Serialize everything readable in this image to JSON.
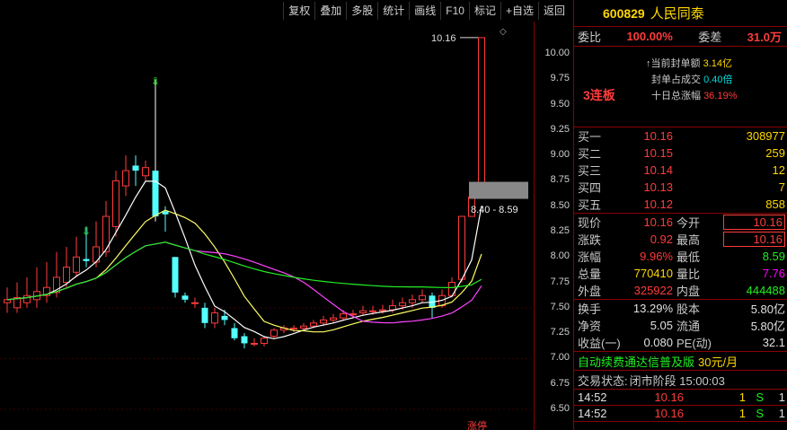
{
  "toolbar": [
    "复权",
    "叠加",
    "多股",
    "统计",
    "画线",
    "F10",
    "标记",
    "+自选",
    "返回"
  ],
  "chart_data": {
    "type": "candlestick",
    "price_ticks": [
      "10.00",
      "9.75",
      "9.50",
      "9.25",
      "9.00",
      "8.75",
      "8.50",
      "8.25",
      "8.00",
      "7.75",
      "7.50",
      "7.25",
      "7.00",
      "6.75",
      "6.50"
    ],
    "annotations": {
      "high_label": "10.16",
      "range_label": "8.40 - 8.59",
      "bottom_label": "涨停"
    },
    "candles": [
      {
        "o": 7.55,
        "c": 7.58,
        "h": 7.7,
        "l": 7.45
      },
      {
        "o": 7.5,
        "c": 7.6,
        "h": 7.75,
        "l": 7.45
      },
      {
        "o": 7.55,
        "c": 7.62,
        "h": 7.8,
        "l": 7.5
      },
      {
        "o": 7.58,
        "c": 7.66,
        "h": 7.9,
        "l": 7.5
      },
      {
        "o": 7.62,
        "c": 7.7,
        "h": 7.95,
        "l": 7.55
      },
      {
        "o": 7.65,
        "c": 7.8,
        "h": 8.05,
        "l": 7.6
      },
      {
        "o": 7.75,
        "c": 7.9,
        "h": 8.1,
        "l": 7.7
      },
      {
        "o": 7.85,
        "c": 8.0,
        "h": 8.2,
        "l": 7.8
      },
      {
        "o": 7.98,
        "c": 7.96,
        "h": 8.3,
        "l": 7.9
      },
      {
        "o": 7.95,
        "c": 8.1,
        "h": 8.35,
        "l": 7.9
      },
      {
        "o": 8.05,
        "c": 8.4,
        "h": 8.55,
        "l": 8.0
      },
      {
        "o": 8.3,
        "c": 8.75,
        "h": 8.85,
        "l": 8.2
      },
      {
        "o": 8.7,
        "c": 8.85,
        "h": 9.0,
        "l": 8.6
      },
      {
        "o": 8.9,
        "c": 8.85,
        "h": 9.0,
        "l": 8.7
      },
      {
        "o": 8.8,
        "c": 8.88,
        "h": 8.95,
        "l": 8.75
      },
      {
        "o": 8.85,
        "c": 8.4,
        "h": 9.75,
        "l": 8.35
      },
      {
        "o": 8.45,
        "c": 8.42,
        "h": 8.5,
        "l": 8.25
      },
      {
        "o": 8.0,
        "c": 7.65,
        "h": 8.0,
        "l": 7.6
      },
      {
        "o": 7.62,
        "c": 7.58,
        "h": 7.65,
        "l": 7.55
      },
      {
        "o": 7.55,
        "c": 7.55,
        "h": 7.6,
        "l": 7.5
      },
      {
        "o": 7.5,
        "c": 7.35,
        "h": 7.55,
        "l": 7.3
      },
      {
        "o": 7.35,
        "c": 7.45,
        "h": 7.5,
        "l": 7.3
      },
      {
        "o": 7.42,
        "c": 7.38,
        "h": 7.48,
        "l": 7.33
      },
      {
        "o": 7.3,
        "c": 7.2,
        "h": 7.35,
        "l": 7.18
      },
      {
        "o": 7.22,
        "c": 7.15,
        "h": 7.25,
        "l": 7.1
      },
      {
        "o": 7.15,
        "c": 7.15,
        "h": 7.2,
        "l": 7.12
      },
      {
        "o": 7.15,
        "c": 7.2,
        "h": 7.22,
        "l": 7.12
      },
      {
        "o": 7.22,
        "c": 7.28,
        "h": 7.3,
        "l": 7.2
      },
      {
        "o": 7.28,
        "c": 7.3,
        "h": 7.33,
        "l": 7.25
      },
      {
        "o": 7.3,
        "c": 7.3,
        "h": 7.33,
        "l": 7.26
      },
      {
        "o": 7.3,
        "c": 7.32,
        "h": 7.35,
        "l": 7.28
      },
      {
        "o": 7.32,
        "c": 7.35,
        "h": 7.38,
        "l": 7.3
      },
      {
        "o": 7.35,
        "c": 7.38,
        "h": 7.42,
        "l": 7.32
      },
      {
        "o": 7.38,
        "c": 7.4,
        "h": 7.44,
        "l": 7.35
      },
      {
        "o": 7.4,
        "c": 7.44,
        "h": 7.48,
        "l": 7.37
      },
      {
        "o": 7.44,
        "c": 7.44,
        "h": 7.48,
        "l": 7.4
      },
      {
        "o": 7.45,
        "c": 7.47,
        "h": 7.52,
        "l": 7.42
      },
      {
        "o": 7.47,
        "c": 7.47,
        "h": 7.52,
        "l": 7.43
      },
      {
        "o": 7.47,
        "c": 7.48,
        "h": 7.53,
        "l": 7.44
      },
      {
        "o": 7.48,
        "c": 7.52,
        "h": 7.58,
        "l": 7.45
      },
      {
        "o": 7.52,
        "c": 7.55,
        "h": 7.6,
        "l": 7.48
      },
      {
        "o": 7.55,
        "c": 7.58,
        "h": 7.63,
        "l": 7.5
      },
      {
        "o": 7.58,
        "c": 7.62,
        "h": 7.68,
        "l": 7.55
      },
      {
        "o": 7.62,
        "c": 7.5,
        "h": 7.65,
        "l": 7.4
      },
      {
        "o": 7.52,
        "c": 7.62,
        "h": 7.68,
        "l": 7.5
      },
      {
        "o": 7.62,
        "c": 7.75,
        "h": 7.8,
        "l": 7.6
      },
      {
        "o": 7.78,
        "c": 8.4,
        "h": 8.4,
        "l": 7.75
      },
      {
        "o": 8.4,
        "c": 8.59,
        "h": 8.59,
        "l": 8.4
      },
      {
        "o": 8.59,
        "c": 10.16,
        "h": 10.16,
        "l": 8.59
      }
    ]
  },
  "quote": {
    "code": "600829",
    "name": "人民同泰",
    "weibi_label": "委比",
    "weibi": "100.00%",
    "weicha_label": "委差",
    "weicha": "31.0万",
    "seal_label": "当前封单额",
    "seal": "3.14亿",
    "seal_ratio_label": "封单占成交",
    "seal_ratio": "0.40倍",
    "ten_day_label": "十日总涨幅",
    "ten_day": "36.19%",
    "streak": "3连板",
    "bids": [
      {
        "label": "买一",
        "price": "10.16",
        "vol": "308977"
      },
      {
        "label": "买二",
        "price": "10.15",
        "vol": "259"
      },
      {
        "label": "买三",
        "price": "10.14",
        "vol": "12"
      },
      {
        "label": "买四",
        "price": "10.13",
        "vol": "7"
      },
      {
        "label": "买五",
        "price": "10.12",
        "vol": "858"
      }
    ],
    "stats": [
      {
        "l1": "现价",
        "v1": "10.16",
        "l2": "今开",
        "v2": "10.16"
      },
      {
        "l1": "涨跌",
        "v1": "0.92",
        "l2": "最高",
        "v2": "10.16"
      },
      {
        "l1": "涨幅",
        "v1": "9.96%",
        "l2": "最低",
        "v2": "8.59"
      },
      {
        "l1": "总量",
        "v1": "770410",
        "l2": "量比",
        "v2": "7.76"
      },
      {
        "l1": "外盘",
        "v1": "325922",
        "l2": "内盘",
        "v2": "444488"
      }
    ],
    "stats2": [
      {
        "l1": "换手",
        "v1": "13.29%",
        "l2": "股本",
        "v2": "5.80亿"
      },
      {
        "l1": "净资",
        "v1": "5.05",
        "l2": "流通",
        "v2": "5.80亿"
      },
      {
        "l1": "收益(一)",
        "v1": "0.080",
        "l2": "PE(动)",
        "v2": "32.1"
      }
    ],
    "promo": "自动续费通达信普及版",
    "promo_price": "30元/月",
    "status_label": "交易状态:",
    "status": "闭市阶段 15:00:03",
    "ticks": [
      {
        "time": "14:52",
        "price": "10.16",
        "vol": "1",
        "side": "S",
        "n": "1"
      },
      {
        "time": "14:52",
        "price": "10.16",
        "vol": "1",
        "side": "S",
        "n": "1"
      }
    ]
  }
}
